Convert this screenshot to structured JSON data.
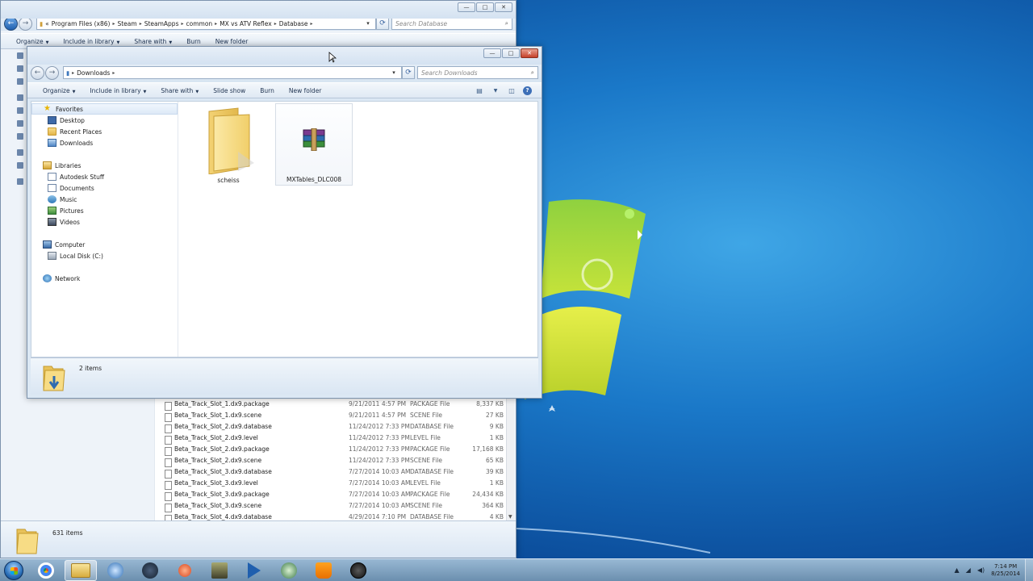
{
  "back_window": {
    "address": [
      "Program Files (x86)",
      "Steam",
      "SteamApps",
      "common",
      "MX vs ATV Reflex",
      "Database"
    ],
    "address_prefix": "«",
    "search_placeholder": "Search Database",
    "toolbar": {
      "organize": "Organize",
      "include": "Include in library",
      "share": "Share with",
      "burn": "Burn",
      "new_folder": "New folder"
    },
    "files": [
      {
        "name": "Beta_Track_Slot_1.dx9.package",
        "date": "9/21/2011 4:57 PM",
        "type": "PACKAGE File",
        "size": "8,337 KB"
      },
      {
        "name": "Beta_Track_Slot_1.dx9.scene",
        "date": "9/21/2011 4:57 PM",
        "type": "SCENE File",
        "size": "27 KB"
      },
      {
        "name": "Beta_Track_Slot_2.dx9.database",
        "date": "11/24/2012 7:33 PM",
        "type": "DATABASE File",
        "size": "9 KB"
      },
      {
        "name": "Beta_Track_Slot_2.dx9.level",
        "date": "11/24/2012 7:33 PM",
        "type": "LEVEL File",
        "size": "1 KB"
      },
      {
        "name": "Beta_Track_Slot_2.dx9.package",
        "date": "11/24/2012 7:33 PM",
        "type": "PACKAGE File",
        "size": "17,168 KB"
      },
      {
        "name": "Beta_Track_Slot_2.dx9.scene",
        "date": "11/24/2012 7:33 PM",
        "type": "SCENE File",
        "size": "65 KB"
      },
      {
        "name": "Beta_Track_Slot_3.dx9.database",
        "date": "7/27/2014 10:03 AM",
        "type": "DATABASE File",
        "size": "39 KB"
      },
      {
        "name": "Beta_Track_Slot_3.dx9.level",
        "date": "7/27/2014 10:03 AM",
        "type": "LEVEL File",
        "size": "1 KB"
      },
      {
        "name": "Beta_Track_Slot_3.dx9.package",
        "date": "7/27/2014 10:03 AM",
        "type": "PACKAGE File",
        "size": "24,434 KB"
      },
      {
        "name": "Beta_Track_Slot_3.dx9.scene",
        "date": "7/27/2014 10:03 AM",
        "type": "SCENE File",
        "size": "364 KB"
      },
      {
        "name": "Beta_Track_Slot_4.dx9.database",
        "date": "4/29/2014 7:10 PM",
        "type": "DATABASE File",
        "size": "4 KB"
      }
    ],
    "status": "631 items"
  },
  "front_window": {
    "address": [
      "Downloads"
    ],
    "search_placeholder": "Search Downloads",
    "toolbar": {
      "organize": "Organize",
      "include": "Include in library",
      "share": "Share with",
      "slideshow": "Slide show",
      "burn": "Burn",
      "new_folder": "New folder"
    },
    "nav": {
      "favorites": "Favorites",
      "desktop": "Desktop",
      "recent": "Recent Places",
      "downloads": "Downloads",
      "libraries": "Libraries",
      "autodesk": "Autodesk Stuff",
      "documents": "Documents",
      "music": "Music",
      "pictures": "Pictures",
      "videos": "Videos",
      "computer": "Computer",
      "localdisk": "Local Disk (C:)",
      "network": "Network"
    },
    "items": [
      {
        "name": "scheiss",
        "kind": "folder"
      },
      {
        "name": "MXTables_DLC008",
        "kind": "rar-archive"
      }
    ],
    "status": "2 items"
  },
  "taskbar": {
    "apps": [
      "chrome-icon",
      "explorer-icon",
      "monitor-icon",
      "steam-icon",
      "app-red-icon",
      "app-dark-icon",
      "media-player-icon",
      "audio-icon",
      "vlc-icon",
      "obs-icon"
    ],
    "time": "7:14 PM",
    "date": "8/25/2014"
  }
}
